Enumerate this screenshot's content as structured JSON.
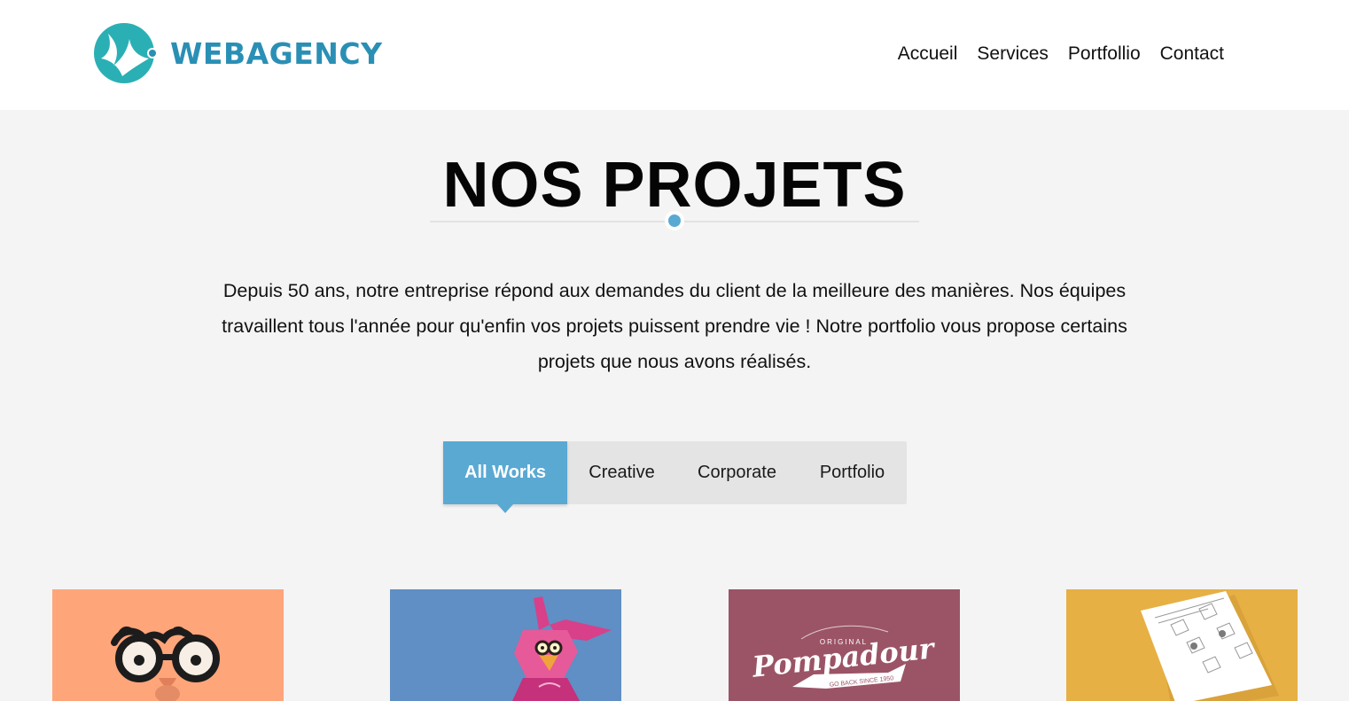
{
  "brand": {
    "name": "WEBAGENCY",
    "color": "#2a8fb5"
  },
  "nav": [
    {
      "label": "Accueil"
    },
    {
      "label": "Services"
    },
    {
      "label": "Portfollio"
    },
    {
      "label": "Contact"
    }
  ],
  "page": {
    "title": "NOS PROJETS",
    "intro": "Depuis 50 ans, notre entreprise répond aux demandes du client de la meilleure des manières. Nos équipes travaillent tous l'année pour qu'enfin vos projets puissent prendre vie ! Notre portfolio vous propose certains projets que nous avons réalisés."
  },
  "filters": {
    "active": "All Works",
    "items": [
      {
        "label": "All Works"
      },
      {
        "label": "Creative"
      },
      {
        "label": "Corporate"
      },
      {
        "label": "Portfolio"
      }
    ]
  },
  "colors": {
    "accent": "#5aa9d3",
    "page_background": "#f4f4f4",
    "header_background": "#ffffff",
    "filter_background": "#e4e4e4"
  },
  "portfolio": [
    {
      "image": "glasses-illustration",
      "background": "#ffa57a"
    },
    {
      "image": "pink-bunny-illustration",
      "background": "#5f8fc4"
    },
    {
      "image": "pompadour-logo",
      "background": "#9b5466",
      "logo_small": "ORIGINAL",
      "logo_title": "Pompadour",
      "logo_ribbon": "GO BACK SINCE 1950"
    },
    {
      "image": "stationery-mockup",
      "background": "#e6b044"
    }
  ]
}
